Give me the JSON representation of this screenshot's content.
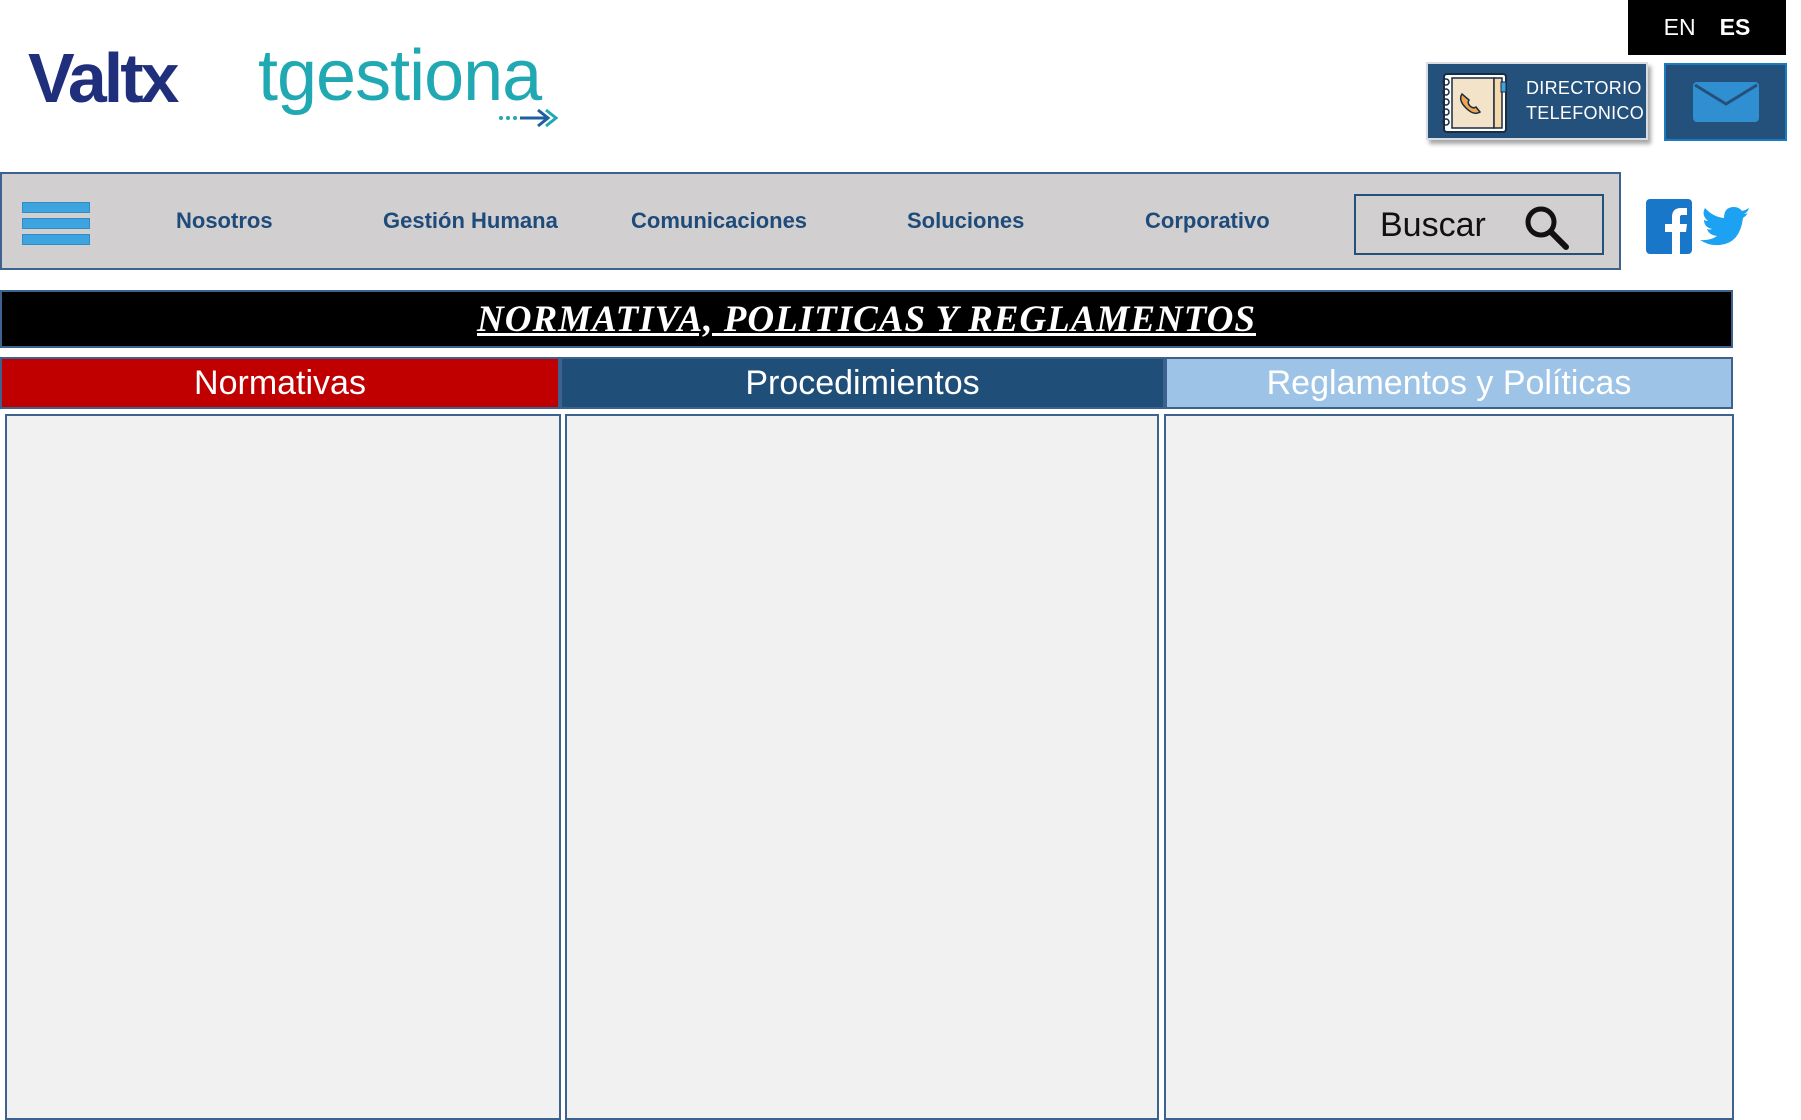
{
  "header": {
    "brand_primary": "Valtx",
    "brand_secondary": "tgestiona"
  },
  "language": {
    "en_label": "EN",
    "es_label": "ES",
    "active": "ES"
  },
  "directory": {
    "line1": "DIRECTORIO",
    "line2": "TELEFONICO"
  },
  "nav": {
    "items": [
      {
        "label": "Nosotros"
      },
      {
        "label": "Gestión Humana"
      },
      {
        "label": "Comunicaciones"
      },
      {
        "label": "Soluciones"
      },
      {
        "label": "Corporativo"
      }
    ],
    "search_label": "Buscar"
  },
  "page": {
    "title": "NORMATIVA, POLITICAS Y REGLAMENTOS"
  },
  "tabs": [
    {
      "label": "Normativas",
      "color": "#c00000"
    },
    {
      "label": "Procedimientos",
      "color": "#1f4e79"
    },
    {
      "label": "Reglamentos y Políticas",
      "color": "#9dc3e6"
    }
  ],
  "icons": {
    "directory": "phone-book-icon",
    "mail": "mail-icon",
    "menu": "hamburger-menu-icon",
    "search": "search-icon",
    "facebook": "facebook-icon",
    "twitter": "twitter-icon"
  },
  "colors": {
    "brand_navy": "#1f2f7c",
    "brand_teal": "#20a9b2",
    "nav_bg": "#d1cfd0",
    "nav_text": "#1f4b7a",
    "button_blue": "#24507c"
  }
}
